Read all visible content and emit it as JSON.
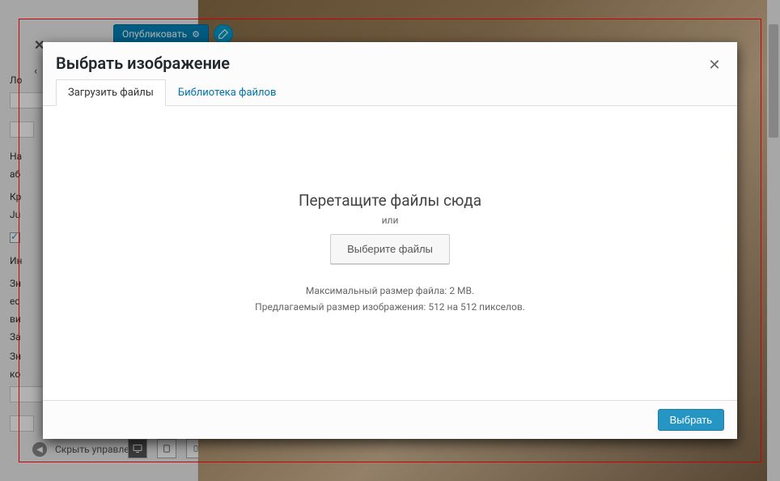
{
  "background": {
    "publish_label": "Опубликовать",
    "collapse_label": "Скрыть управление",
    "sidebar": {
      "labels": [
        "Ло",
        "На",
        "аб",
        "Кр",
        "Ju",
        "Ин",
        "Зн",
        "ес",
        "ви",
        "За",
        "Зн",
        "ко"
      ]
    }
  },
  "modal": {
    "title": "Выбрать изображение",
    "tabs": {
      "upload": "Загрузить файлы",
      "library": "Библиотека файлов"
    },
    "drop": {
      "title": "Перетащите файлы сюда",
      "or": "или",
      "button": "Выберите файлы"
    },
    "info": {
      "max_size": "Максимальный размер файла: 2 MB.",
      "suggested": "Предлагаемый размер изображения: 512 на 512 пикселов."
    },
    "footer": {
      "select": "Выбрать"
    }
  }
}
